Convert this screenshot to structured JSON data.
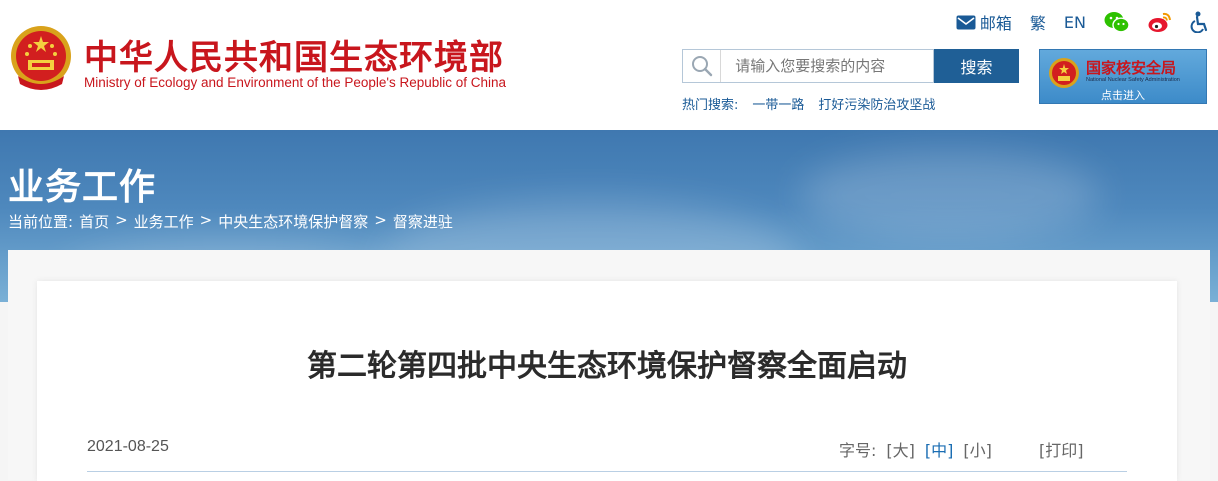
{
  "header": {
    "title": "中华人民共和国生态环境部",
    "subtitle": "Ministry of Ecology and Environment of the People's Republic of China",
    "top_links": {
      "mail": "邮箱",
      "traditional": "繁",
      "english": "EN"
    },
    "search": {
      "placeholder": "请输入您要搜索的内容",
      "button": "搜索"
    },
    "hot": {
      "label": "热门搜索:",
      "items": [
        "一带一路",
        "打好污染防治攻坚战"
      ]
    },
    "nnsa": {
      "name": "国家核安全局",
      "english": "National Nuclear Safety Administration",
      "enter": "点击进入"
    }
  },
  "banner": {
    "section": "业务工作",
    "breadcrumb": {
      "label": "当前位置:",
      "items": [
        "首页",
        "业务工作",
        "中央生态环境保护督察",
        "督察进驻"
      ],
      "sep": ">"
    }
  },
  "article": {
    "title": "第二轮第四批中央生态环境保护督察全面启动",
    "date": "2021-08-25",
    "font_size": {
      "label": "字号:",
      "large": "[大]",
      "medium": "[中]",
      "small": "[小]"
    },
    "print": "[打印]"
  },
  "colors": {
    "brand_red": "#c8161d",
    "link_blue": "#1a5a96",
    "search_button": "#1f5f96",
    "wechat_green": "#2dc100",
    "weibo_red": "#e6162d"
  }
}
